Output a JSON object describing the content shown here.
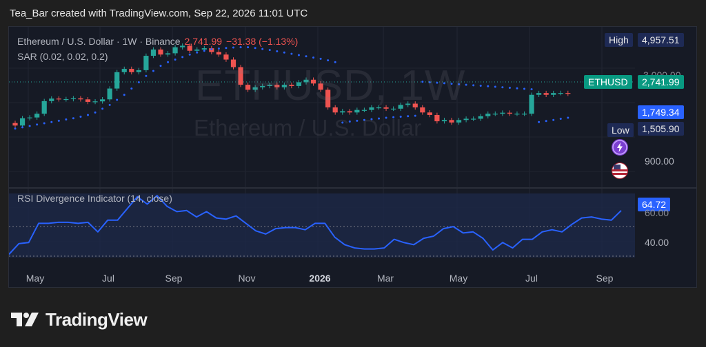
{
  "header": {
    "text": "Tea_Bar created with TradingView.com, Sep 22, 2026 11:01 UTC"
  },
  "legend": {
    "symbol": "Ethereum / U.S. Dollar · 1W · Binance",
    "last": "2,741.99",
    "change": "−31.38 (−1.13%)",
    "sar": "SAR (0.02, 0.02, 0.2)",
    "rsi": "RSI Divergence Indicator (14, close)"
  },
  "watermark": {
    "line1": "ETHUSD, 1W",
    "line2": "Ethereum / U.S. Dollar"
  },
  "price_scale": {
    "high_label": "High",
    "high_value": "4,957.51",
    "low_label": "Low",
    "low_value": "1,505.90",
    "ticker": "ETHUSD",
    "ticker_value": "2,741.99",
    "sar_value": "1,749.34",
    "tick_3000": "3,000.00",
    "tick_900": "900.00"
  },
  "rsi_scale": {
    "tick_60": "60.00",
    "tick_40": "40.00",
    "value": "64.72"
  },
  "time_axis": [
    "May",
    "Jul",
    "Sep",
    "Nov",
    "2026",
    "Mar",
    "May",
    "Jul",
    "Sep"
  ],
  "brand": {
    "name": "TradingView"
  },
  "colors": {
    "up": "#26a69a",
    "down": "#ef5350",
    "sar": "#2962ff",
    "rsi": "#2962ff",
    "bg": "#161a25"
  },
  "icons": [
    "lightning-icon",
    "us-flag-icon",
    "tradingview-logo-icon"
  ],
  "chart_data": [
    {
      "type": "candlestick",
      "title": "Ethereum / U.S. Dollar · 1W · Binance",
      "ylim": [
        -1000,
        5400
      ],
      "x": [
        "2025-04-07",
        "2025-04-14",
        "2025-04-21",
        "2025-04-28",
        "2025-05-05",
        "2025-05-12",
        "2025-05-19",
        "2025-05-26",
        "2025-06-02",
        "2025-06-09",
        "2025-06-16",
        "2025-06-23",
        "2025-06-30",
        "2025-07-07",
        "2025-07-14",
        "2025-07-21",
        "2025-07-28",
        "2025-08-04",
        "2025-08-11",
        "2025-08-18",
        "2025-08-25",
        "2025-09-01",
        "2025-09-08",
        "2025-09-15",
        "2025-09-22",
        "2025-09-29",
        "2025-10-06",
        "2025-10-13",
        "2025-10-20",
        "2025-10-27",
        "2025-11-03",
        "2025-11-10",
        "2025-11-17",
        "2025-11-24",
        "2025-12-01",
        "2025-12-08",
        "2025-12-15",
        "2025-12-22",
        "2025-12-29",
        "2026-01-05",
        "2026-01-12",
        "2026-01-19",
        "2026-01-26",
        "2026-02-02",
        "2026-02-09",
        "2026-02-16",
        "2026-02-23",
        "2026-03-02",
        "2026-03-09",
        "2026-03-16",
        "2026-03-23",
        "2026-03-30",
        "2026-04-06",
        "2026-04-13",
        "2026-04-20",
        "2026-04-27",
        "2026-05-04",
        "2026-05-11",
        "2026-05-18",
        "2026-05-25",
        "2026-06-01",
        "2026-06-08",
        "2026-06-15",
        "2026-06-22",
        "2026-06-29",
        "2026-07-06",
        "2026-07-13",
        "2026-07-20",
        "2026-07-27",
        "2026-08-03",
        "2026-08-10",
        "2026-08-17",
        "2026-08-24",
        "2026-08-31",
        "2026-09-07",
        "2026-09-14",
        "2026-09-21"
      ],
      "open": [
        1580,
        1480,
        1770,
        1800,
        1950,
        2450,
        2550,
        2520,
        2530,
        2560,
        2520,
        2420,
        2440,
        2520,
        2950,
        3600,
        3730,
        3600,
        3680,
        4250,
        4500,
        4300,
        4350,
        4590,
        4650,
        4450,
        4500,
        4550,
        4400,
        4300,
        4100,
        3800,
        3100,
        2900,
        3000,
        3050,
        3100,
        3000,
        3100,
        3050,
        3200,
        3300,
        3150,
        2900,
        2200,
        2000,
        2050,
        2000,
        2100,
        2100,
        2200,
        2200,
        2150,
        2150,
        2300,
        2350,
        2200,
        2000,
        1900,
        1650,
        1700,
        1600,
        1700,
        1750,
        1750,
        1850,
        1950,
        1950,
        1990,
        1950,
        1950,
        1950,
        2700,
        2770,
        2700,
        2770,
        2773
      ],
      "close": [
        1480,
        1770,
        1800,
        1950,
        2450,
        2550,
        2520,
        2530,
        2560,
        2520,
        2420,
        2440,
        2520,
        2950,
        3600,
        3730,
        3600,
        3680,
        4250,
        4500,
        4300,
        4350,
        4590,
        4650,
        4450,
        4500,
        4550,
        4400,
        4300,
        4100,
        3800,
        3100,
        2900,
        3000,
        3050,
        3100,
        3000,
        3100,
        3050,
        3200,
        3300,
        3150,
        2900,
        2200,
        2000,
        2050,
        2000,
        2100,
        2100,
        2200,
        2200,
        2150,
        2150,
        2300,
        2350,
        2200,
        2000,
        1900,
        1650,
        1700,
        1600,
        1700,
        1750,
        1750,
        1850,
        1950,
        1950,
        1990,
        1950,
        1950,
        1950,
        2700,
        2770,
        2700,
        2770,
        2773,
        2742
      ],
      "sar": [
        1360,
        1410,
        1460,
        1520,
        1570,
        1620,
        1670,
        1720,
        1770,
        1830,
        1900,
        2000,
        2150,
        2300,
        2500,
        2700,
        2950,
        3200,
        3450,
        3650,
        3850,
        4000,
        4100,
        4200,
        4300,
        4380,
        4450,
        4510,
        4540,
        4560,
        4580,
        4590,
        4590,
        4560,
        4520,
        4480,
        4430,
        4380,
        4330,
        4280,
        4230,
        4180,
        4130,
        4070,
        4000,
        1600,
        1640,
        1670,
        1700,
        1730,
        1760,
        1790,
        1810,
        1830,
        1850,
        1870,
        3220,
        3200,
        3180,
        3160,
        3140,
        3120,
        3100,
        3080,
        3060,
        3040,
        3020,
        3000,
        2980,
        2960,
        2940,
        2920,
        1620,
        1660,
        1700,
        1749,
        1790
      ]
    },
    {
      "type": "line",
      "title": "RSI Divergence Indicator (14, close)",
      "ylim": [
        20,
        80
      ],
      "series": [
        {
          "values": [
            23,
            33,
            34,
            52,
            52,
            53,
            53,
            52,
            53,
            44,
            55,
            55,
            66,
            77,
            70,
            78,
            68,
            63,
            64,
            58,
            63,
            57,
            56,
            59,
            52,
            45,
            42,
            47,
            48,
            48,
            46,
            52,
            52,
            39,
            32,
            29,
            28,
            28,
            29,
            37,
            34,
            32,
            38,
            40,
            47,
            49,
            43,
            44,
            38,
            27,
            34,
            29,
            37,
            37,
            44,
            46,
            44,
            51,
            57,
            58,
            56,
            55,
            64
          ]
        }
      ]
    }
  ]
}
